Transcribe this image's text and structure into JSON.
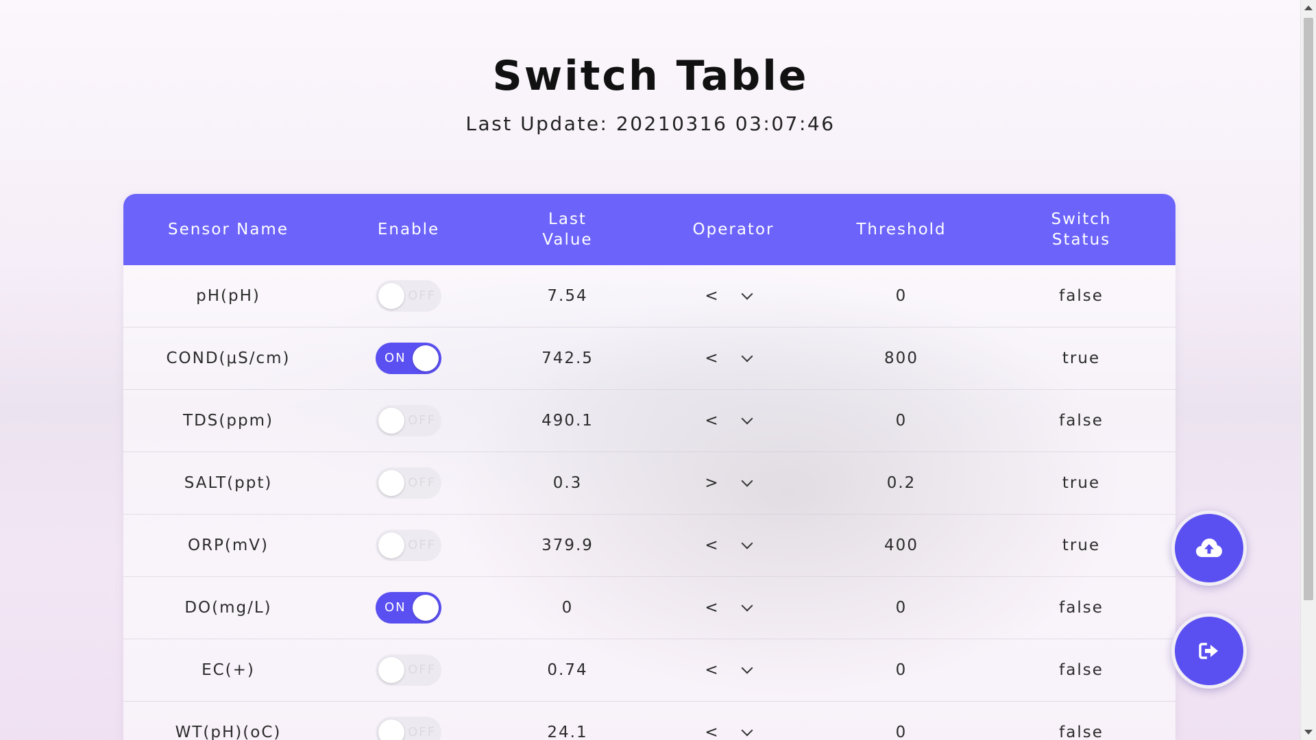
{
  "page": {
    "title": "Switch Table",
    "last_update": "Last Update: 20210316 03:07:46"
  },
  "table": {
    "headers": {
      "sensor_name": "Sensor Name",
      "enable": "Enable",
      "last_value_1": "Last",
      "last_value_2": "Value",
      "operator": "Operator",
      "threshold": "Threshold",
      "switch_status_1": "Switch",
      "switch_status_2": "Status"
    },
    "toggle_labels": {
      "on": "ON",
      "off": "OFF"
    },
    "rows": [
      {
        "sensor": "pH(pH)",
        "enabled": false,
        "last_value": "7.54",
        "operator": "<",
        "threshold": "0",
        "status": "false"
      },
      {
        "sensor": "COND(μS/cm)",
        "enabled": true,
        "last_value": "742.5",
        "operator": "<",
        "threshold": "800",
        "status": "true"
      },
      {
        "sensor": "TDS(ppm)",
        "enabled": false,
        "last_value": "490.1",
        "operator": "<",
        "threshold": "0",
        "status": "false"
      },
      {
        "sensor": "SALT(ppt)",
        "enabled": false,
        "last_value": "0.3",
        "operator": ">",
        "threshold": "0.2",
        "status": "true"
      },
      {
        "sensor": "ORP(mV)",
        "enabled": false,
        "last_value": "379.9",
        "operator": "<",
        "threshold": "400",
        "status": "true"
      },
      {
        "sensor": "DO(mg/L)",
        "enabled": true,
        "last_value": "0",
        "operator": "<",
        "threshold": "0",
        "status": "false"
      },
      {
        "sensor": "EC(+)",
        "enabled": false,
        "last_value": "0.74",
        "operator": "<",
        "threshold": "0",
        "status": "false"
      },
      {
        "sensor": "WT(pH)(oC)",
        "enabled": false,
        "last_value": "24.1",
        "operator": "<",
        "threshold": "0",
        "status": "false"
      }
    ]
  },
  "actions": {
    "upload_icon": "cloud-upload-icon",
    "logout_icon": "sign-out-icon"
  },
  "colors": {
    "accent": "#6c63fb",
    "toggle_on": "#5a4ff0"
  }
}
